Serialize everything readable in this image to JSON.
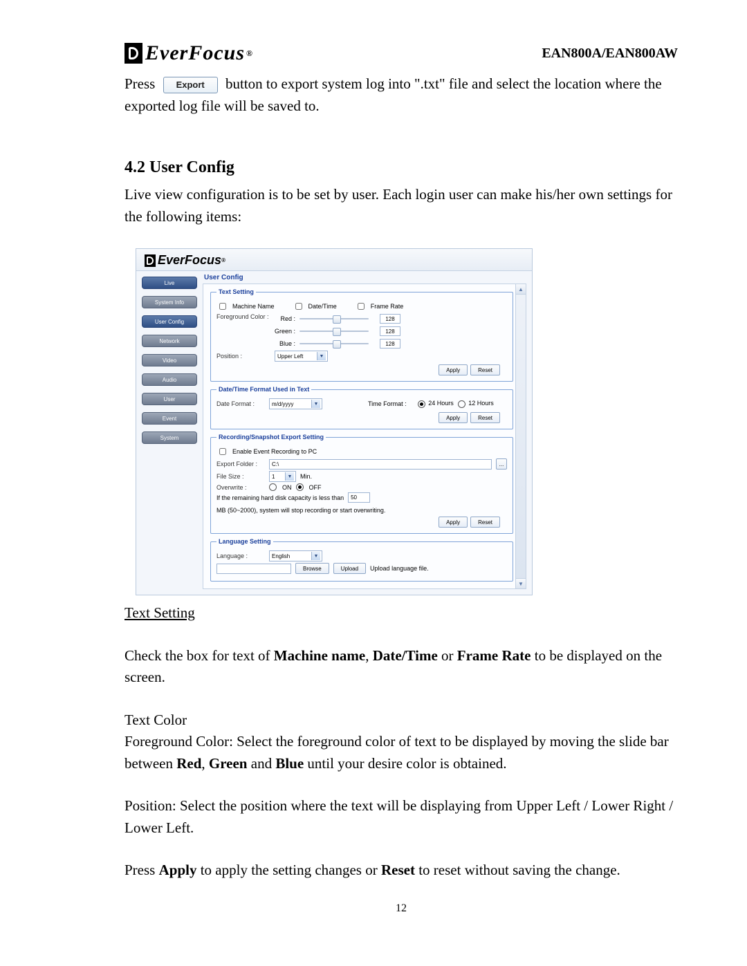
{
  "header": {
    "logo_text": "EverFocus",
    "model": "EAN800A/EAN800AW"
  },
  "intro": {
    "press": "Press",
    "export_btn": "Export",
    "rest": "button to export system log into \".txt\" file and select the location where the exported log file will be saved to."
  },
  "section": {
    "num": "4.2 User Config",
    "desc": "Live view configuration is to be set by user. Each login user can make his/her own settings for the following items:"
  },
  "ui": {
    "logo_text": "EverFocus",
    "nav": [
      "Live",
      "System Info",
      "User Config",
      "Network",
      "Video",
      "Audio",
      "User",
      "Event",
      "System"
    ],
    "content_title": "User Config",
    "text_setting": {
      "legend": "Text Setting",
      "machine_name": "Machine Name",
      "date_time": "Date/Time",
      "frame_rate": "Frame Rate",
      "fg_color": "Foreground Color :",
      "red": "Red :",
      "green": "Green :",
      "blue": "Blue :",
      "color_val": "128",
      "position": "Position :",
      "position_val": "Upper Left",
      "apply": "Apply",
      "reset": "Reset"
    },
    "dtf": {
      "legend": "Date/Time Format Used in Text",
      "date_format": "Date Format :",
      "date_val": "m/d/yyyy",
      "time_format": "Time Format :",
      "h24": "24 Hours",
      "h12": "12 Hours",
      "apply": "Apply",
      "reset": "Reset"
    },
    "rec": {
      "legend": "Recording/Snapshot Export Setting",
      "enable": "Enable Event Recording to PC",
      "export_folder": "Export Folder :",
      "export_val": "C:\\",
      "file_size": "File Size :",
      "file_val": "1",
      "min": "Min.",
      "overwrite": "Overwrite :",
      "on": "ON",
      "off": "OFF",
      "capacity_pre": "If the remaining hard disk capacity is less than",
      "capacity_val": "50",
      "capacity_post": "MB (50~2000), system will stop recording or start overwriting.",
      "apply": "Apply",
      "reset": "Reset"
    },
    "lang": {
      "legend": "Language Setting",
      "language": "Language :",
      "lang_val": "English",
      "browse": "Browse",
      "upload": "Upload",
      "upload_file": "Upload language file."
    }
  },
  "after": {
    "text_setting": "Text Setting",
    "p1a": "Check the box for text of ",
    "p1b": "Machine name",
    "p1c": ", ",
    "p1d": "Date/Time",
    "p1e": " or ",
    "p1f": "Frame Rate",
    "p1g": " to be displayed on the screen.",
    "text_color": "Text Color",
    "p2a": "Foreground Color: Select the foreground color of text to be displayed by moving the slide bar between ",
    "p2b": "Red",
    "p2c": ", ",
    "p2d": "Green",
    "p2e": " and ",
    "p2f": "Blue",
    "p2g": " until your desire color is obtained.",
    "p3": "Position: Select the position where the text will be displaying from Upper Left / Lower Right / Lower Left.",
    "p4a": "Press ",
    "p4b": "Apply",
    "p4c": " to apply the setting changes or ",
    "p4d": "Reset",
    "p4e": " to reset without saving the change."
  },
  "page_num": "12"
}
